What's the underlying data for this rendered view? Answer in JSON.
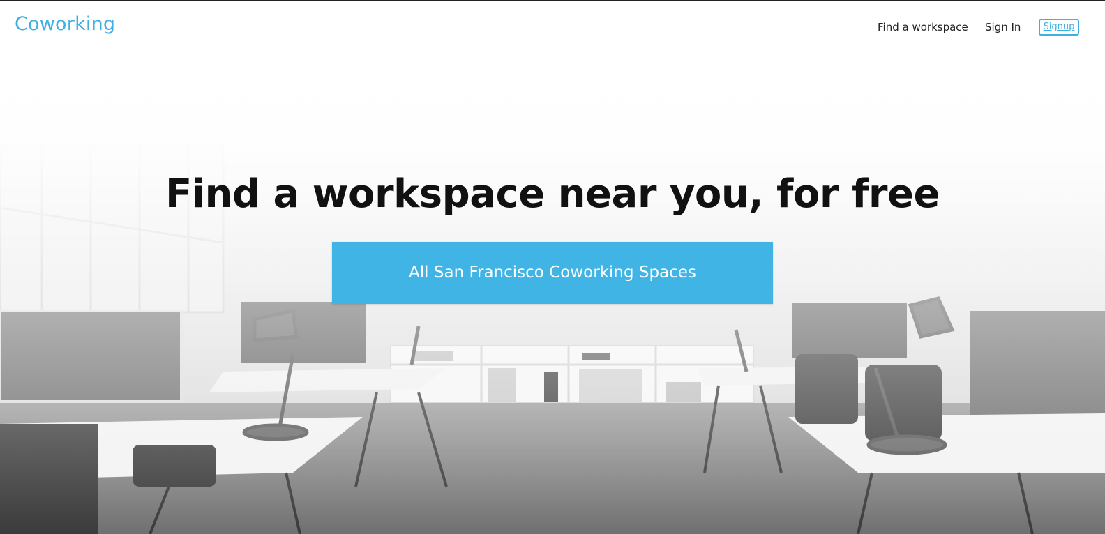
{
  "header": {
    "logo": "Coworking",
    "nav": {
      "find": "Find a workspace",
      "signin": "Sign In",
      "signup": "Signup"
    }
  },
  "hero": {
    "title": "Find a workspace near you, for free",
    "cta": "All San Francisco Coworking Spaces"
  },
  "colors": {
    "accent": "#41b4e6",
    "logo": "#3eb1e2",
    "text": "#111111"
  }
}
